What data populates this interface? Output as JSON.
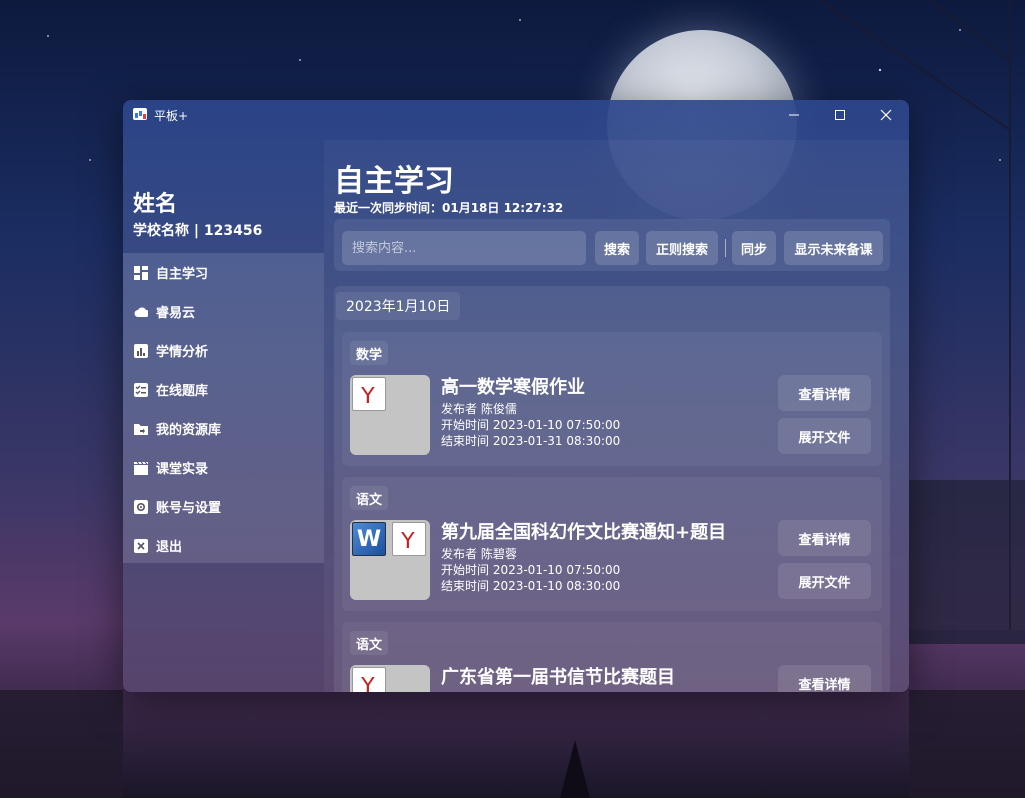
{
  "window": {
    "title": "平板+"
  },
  "user": {
    "name": "姓名",
    "school": "学校名称 | 123456"
  },
  "nav": {
    "items": [
      {
        "label": "自主学习",
        "icon": "dashboard-icon"
      },
      {
        "label": "睿易云",
        "icon": "cloud-icon"
      },
      {
        "label": "学情分析",
        "icon": "chart-icon"
      },
      {
        "label": "在线题库",
        "icon": "checklist-icon"
      },
      {
        "label": "我的资源库",
        "icon": "folder-icon"
      },
      {
        "label": "课堂实录",
        "icon": "film-icon"
      },
      {
        "label": "账号与设置",
        "icon": "gear-icon"
      },
      {
        "label": "退出",
        "icon": "close-icon"
      }
    ]
  },
  "main": {
    "title": "自主学习",
    "sync_time": "最近一次同步时间：01月18日 12:27:32",
    "search": {
      "placeholder": "搜索内容..."
    },
    "buttons": {
      "search": "搜索",
      "regex": "正则搜索",
      "sync": "同步",
      "future": "显示未来备课"
    },
    "date": "2023年1月10日",
    "cards": [
      {
        "subject": "数学",
        "title": "高一数学寒假作业",
        "publisher": "发布者 陈俊儒",
        "start": "开始时间 2023-01-10 07:50:00",
        "end": "结束时间 2023-01-31 08:30:00",
        "files": [
          "pdf-icon"
        ],
        "detail_btn": "查看详情",
        "expand_btn": "展开文件"
      },
      {
        "subject": "语文",
        "title": "第九届全国科幻作文比赛通知+题目",
        "publisher": "发布者 陈碧蓉",
        "start": "开始时间 2023-01-10 07:50:00",
        "end": "结束时间 2023-01-10 08:30:00",
        "files": [
          "word-icon",
          "pdf-icon"
        ],
        "detail_btn": "查看详情",
        "expand_btn": "展开文件"
      },
      {
        "subject": "语文",
        "title": "广东省第一届书信节比赛题目",
        "files": [
          "pdf-icon"
        ],
        "detail_btn": "查看详情"
      }
    ]
  }
}
